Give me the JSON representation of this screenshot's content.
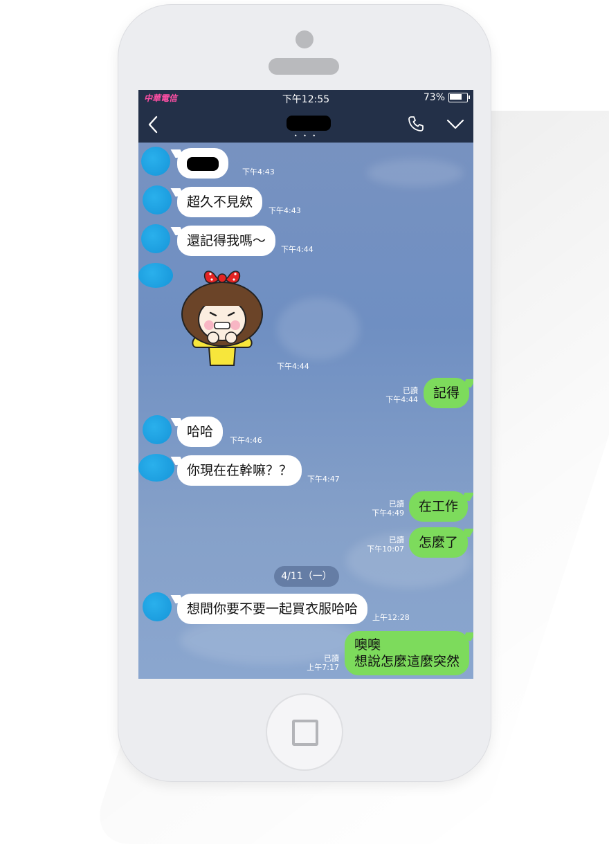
{
  "status_bar": {
    "carrier": "中華電信",
    "time": "下午12:55",
    "battery": "73%"
  },
  "chat": {
    "title": "",
    "page_indicator": "• • •"
  },
  "messages": [
    {
      "side": "in",
      "text": "",
      "time": "下午4:43"
    },
    {
      "side": "in",
      "text": "超久不見欸",
      "time": "下午4:43"
    },
    {
      "side": "in",
      "text": "還記得我嗎～",
      "time": "下午4:44"
    },
    {
      "side": "in",
      "type": "sticker",
      "time": "下午4:44"
    },
    {
      "side": "out",
      "text": "記得",
      "read": "已讀",
      "time": "下午4:44"
    },
    {
      "side": "in",
      "text": "哈哈",
      "time": "下午4:46"
    },
    {
      "side": "in",
      "text": "你現在在幹嘛？？",
      "time": "下午4:47"
    },
    {
      "side": "out",
      "text": "在工作",
      "read": "已讀",
      "time": "下午4:49"
    },
    {
      "side": "out",
      "text": "怎麼了",
      "read": "已讀",
      "time": "下午10:07"
    },
    {
      "side": "in",
      "text": "想問你要不要一起買衣服哈哈",
      "time": "上午12:28"
    },
    {
      "side": "out",
      "lines": [
        "噢噢",
        "想說怎麼這麼突然"
      ],
      "read": "已讀",
      "time": "上午7:17"
    }
  ],
  "date_divider": "4/11（一）",
  "icons": {
    "back": "chevron-left-icon",
    "call": "phone-icon",
    "menu": "chevron-down-icon",
    "home": "home-button-icon"
  },
  "colors": {
    "nav_bar": "#233048",
    "outgoing_bubble": "#7ddb5c",
    "incoming_bubble": "#ffffff",
    "avatar": "#1a9fe0"
  }
}
